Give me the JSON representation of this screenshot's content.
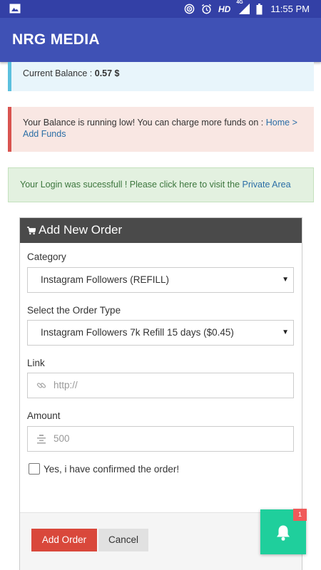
{
  "status_bar": {
    "network_label": "HD",
    "signal_label": "4G",
    "time": "11:55 PM",
    "icons": [
      "image-icon",
      "hotspot-icon",
      "alarm-icon",
      "signal-icon",
      "battery-icon"
    ]
  },
  "app_bar": {
    "title": "NRG MEDIA"
  },
  "balance": {
    "label": "Current Balance : ",
    "value": "0.57 $"
  },
  "low_balance": {
    "text": "Your Balance is running low! You can charge more funds on : ",
    "link": "Home > Add Funds"
  },
  "login_notice": {
    "text": "Your Login was sucessfull ! Please click here to visit the ",
    "link": "Private Area"
  },
  "order_form": {
    "title": "Add New Order",
    "category_label": "Category",
    "category_value": "Instagram Followers (REFILL)",
    "order_type_label": "Select the Order Type",
    "order_type_value": "Instagram Followers 7k Refill 15 days ($0.45)",
    "link_label": "Link",
    "link_placeholder": "http://",
    "amount_label": "Amount",
    "amount_placeholder": "500",
    "confirm_label": "Yes, i have confirmed the order!",
    "confirm_checked": false,
    "add_button": "Add Order",
    "cancel_button": "Cancel"
  },
  "notifications": {
    "count": "1"
  },
  "colors": {
    "status_bar": "#3340a6",
    "app_bar": "#3f51b5",
    "info": "#5bc0de",
    "danger": "#d9534f",
    "success_text": "#3c763d",
    "add_button": "#d9483b",
    "bell_button": "#1fcf9c"
  }
}
